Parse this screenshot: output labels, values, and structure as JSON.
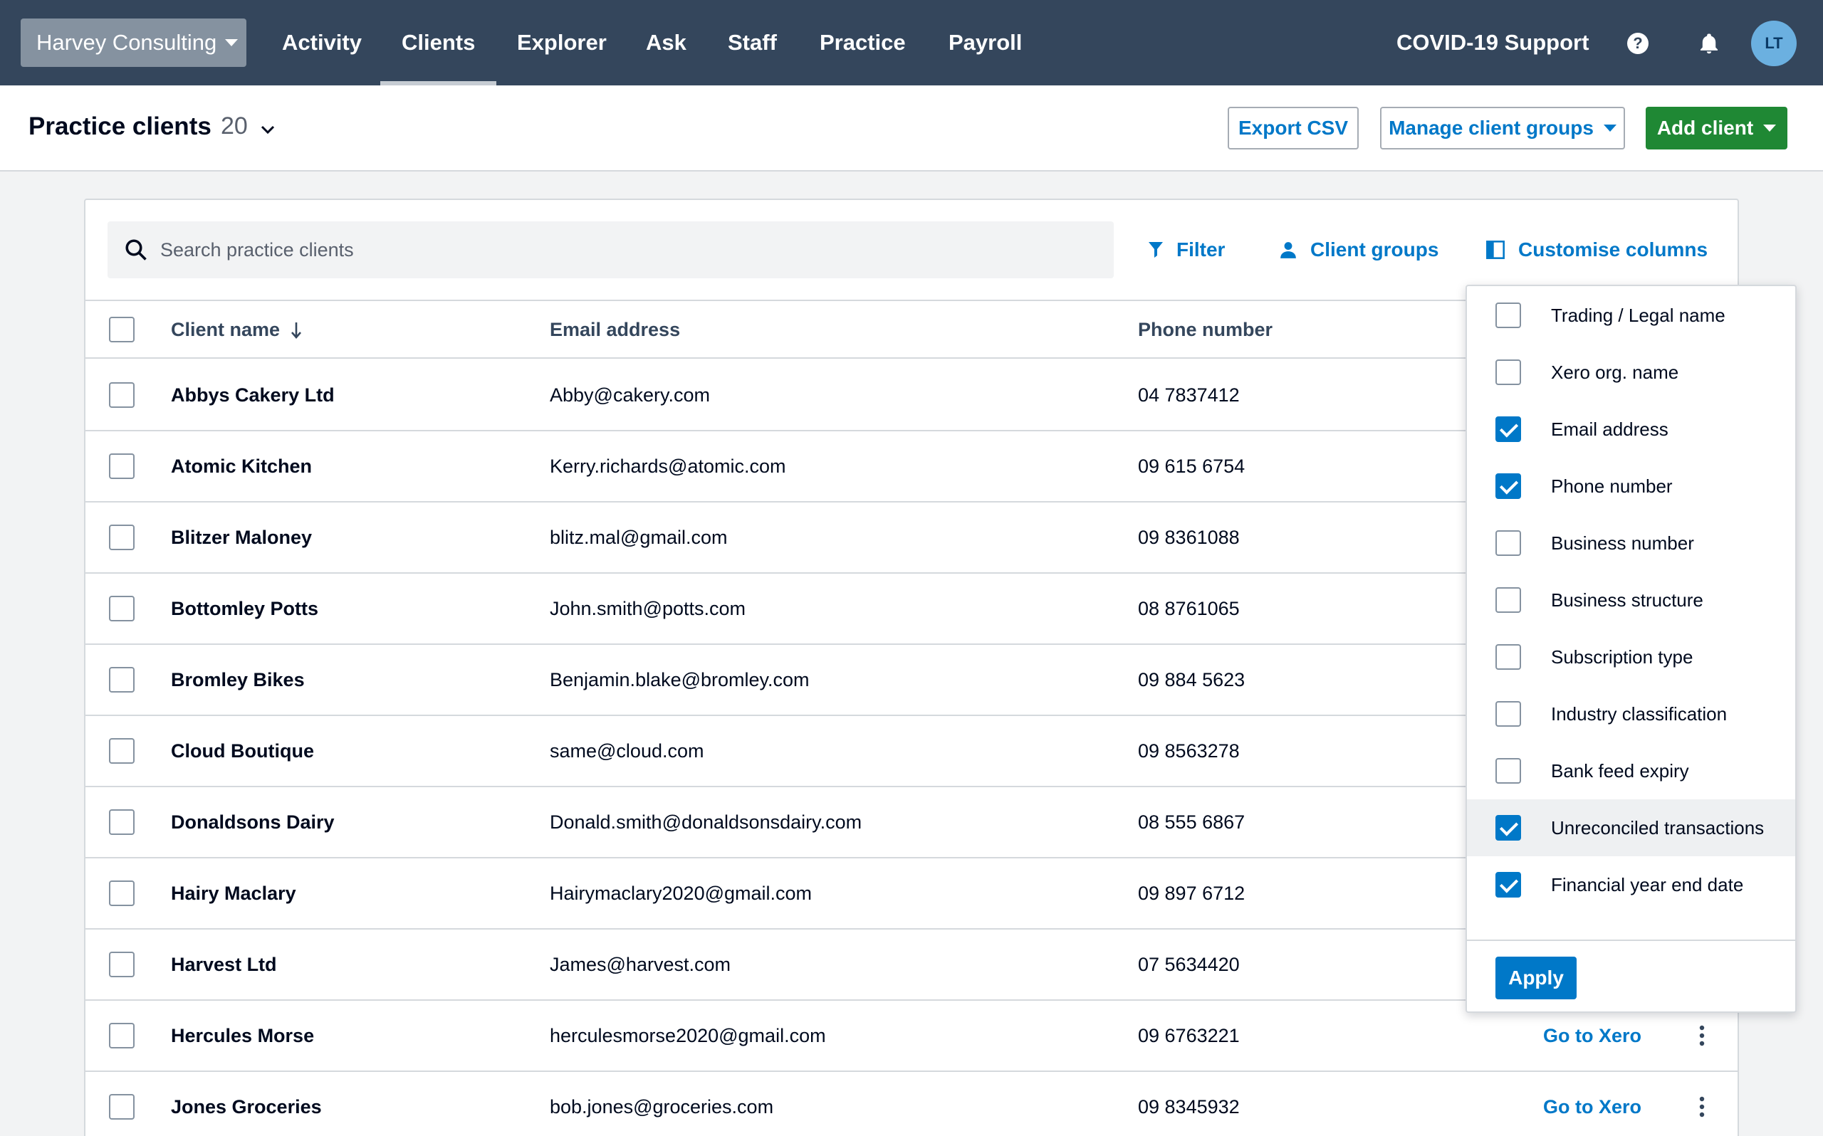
{
  "nav": {
    "org_name": "Harvey Consulting",
    "items": [
      {
        "label": "Activity"
      },
      {
        "label": "Clients"
      },
      {
        "label": "Explorer"
      },
      {
        "label": "Ask"
      },
      {
        "label": "Staff"
      },
      {
        "label": "Practice"
      },
      {
        "label": "Payroll"
      }
    ],
    "active_item": "Clients",
    "covid_label": "COVID-19 Support",
    "help_glyph": "?",
    "avatar_initials": "LT"
  },
  "header": {
    "title": "Practice clients",
    "count": "20",
    "export_label": "Export CSV",
    "manage_groups_label": "Manage client groups",
    "add_client_label": "Add client"
  },
  "toolbar": {
    "search_placeholder": "Search practice clients",
    "filter_label": "Filter",
    "client_groups_label": "Client groups",
    "customise_label": "Customise columns"
  },
  "table": {
    "columns": {
      "name": "Client name",
      "email": "Email address",
      "phone": "Phone number"
    },
    "rows": [
      {
        "name": "Abbys Cakery Ltd",
        "email": "Abby@cakery.com",
        "phone": "04 7837412",
        "action": ""
      },
      {
        "name": "Atomic Kitchen",
        "email": "Kerry.richards@atomic.com",
        "phone": "09 615 6754",
        "action": ""
      },
      {
        "name": "Blitzer Maloney",
        "email": "blitz.mal@gmail.com",
        "phone": "09 8361088",
        "action": ""
      },
      {
        "name": "Bottomley Potts",
        "email": "John.smith@potts.com",
        "phone": "08 8761065",
        "action": ""
      },
      {
        "name": "Bromley Bikes",
        "email": "Benjamin.blake@bromley.com",
        "phone": "09 884 5623",
        "action": ""
      },
      {
        "name": "Cloud Boutique",
        "email": "same@cloud.com",
        "phone": "09 8563278",
        "action": ""
      },
      {
        "name": "Donaldsons Dairy",
        "email": "Donald.smith@donaldsonsdairy.com",
        "phone": "08 555 6867",
        "action": ""
      },
      {
        "name": "Hairy Maclary",
        "email": "Hairymaclary2020@gmail.com",
        "phone": "09 897 6712",
        "action": ""
      },
      {
        "name": "Harvest Ltd",
        "email": "James@harvest.com",
        "phone": "07 5634420",
        "action": ""
      },
      {
        "name": "Hercules Morse",
        "email": "herculesmorse2020@gmail.com",
        "phone": "09 6763221",
        "action": "Go to Xero"
      },
      {
        "name": "Jones Groceries",
        "email": "bob.jones@groceries.com",
        "phone": "09 8345932",
        "action": "Go to Xero"
      }
    ]
  },
  "columns_panel": {
    "options": [
      {
        "label": "Trading / Legal name",
        "checked": false
      },
      {
        "label": "Xero org. name",
        "checked": false
      },
      {
        "label": "Email address",
        "checked": true
      },
      {
        "label": "Phone number",
        "checked": true
      },
      {
        "label": "Business number",
        "checked": false
      },
      {
        "label": "Business structure",
        "checked": false
      },
      {
        "label": "Subscription type",
        "checked": false
      },
      {
        "label": "Industry classification",
        "checked": false
      },
      {
        "label": "Bank feed expiry",
        "checked": false
      },
      {
        "label": "Unreconciled transactions",
        "checked": true
      },
      {
        "label": "Financial year end date",
        "checked": true
      }
    ],
    "highlighted_option": "Unreconciled transactions",
    "apply_label": "Apply"
  },
  "colors": {
    "nav_bg": "#34465c",
    "accent_blue": "#0078c8",
    "primary_green": "#1f8834"
  }
}
